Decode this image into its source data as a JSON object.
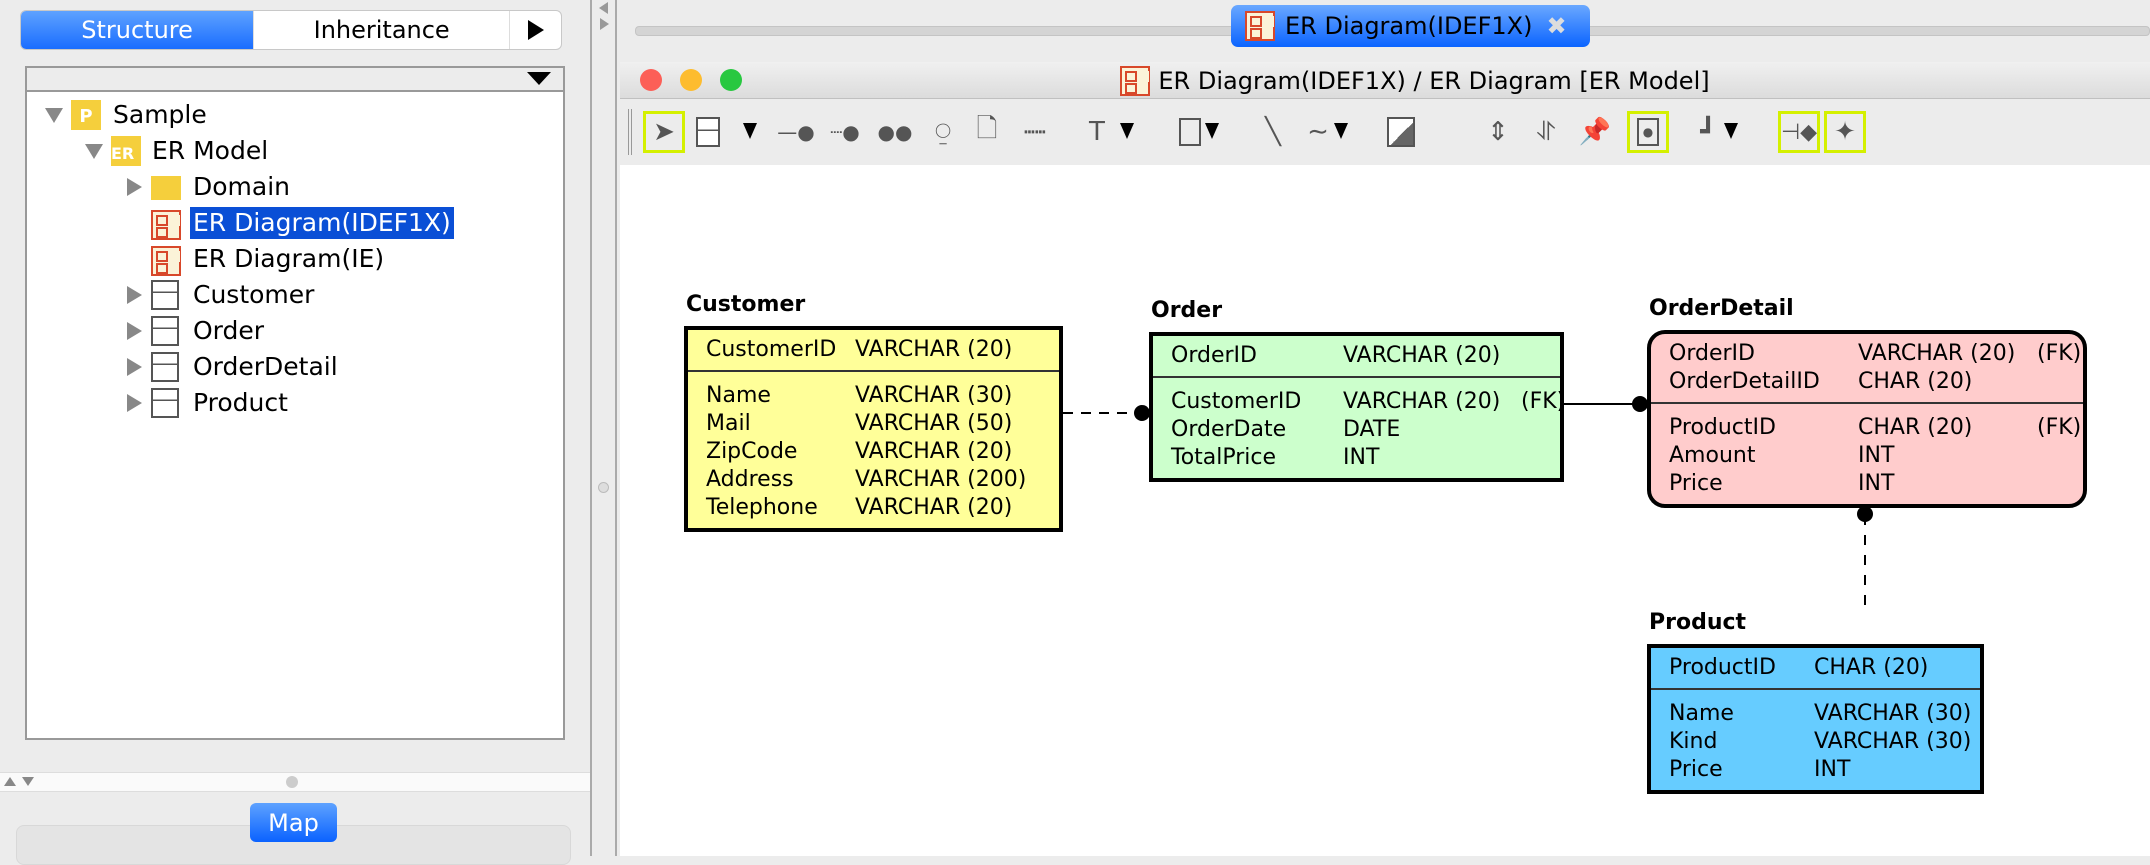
{
  "left_panel": {
    "tabs": [
      {
        "label": "Structure",
        "active": true
      },
      {
        "label": "Inheritance",
        "active": false
      }
    ],
    "tabs_more_icon": "play-right-icon",
    "tree": [
      {
        "label": "Sample",
        "icon": "project-icon",
        "level": 0,
        "expanded": true
      },
      {
        "label": "ER Model",
        "icon": "er-model-icon",
        "level": 1,
        "expanded": true
      },
      {
        "label": "Domain",
        "icon": "folder-icon",
        "level": 2,
        "expanded": false
      },
      {
        "label": "ER Diagram(IDEF1X)",
        "icon": "er-diagram-icon",
        "level": 2,
        "selected": true
      },
      {
        "label": "ER Diagram(IE)",
        "icon": "er-diagram-icon",
        "level": 2
      },
      {
        "label": "Customer",
        "icon": "entity-icon",
        "level": 2,
        "expanded": false
      },
      {
        "label": "Order",
        "icon": "entity-icon",
        "level": 2,
        "expanded": false
      },
      {
        "label": "OrderDetail",
        "icon": "entity-icon",
        "level": 2,
        "expanded": false
      },
      {
        "label": "Product",
        "icon": "entity-icon",
        "level": 2,
        "expanded": false
      }
    ],
    "map_button": "Map"
  },
  "editor": {
    "tab_label": "ER Diagram(IDEF1X)",
    "window_title": "ER Diagram(IDEF1X) / ER Diagram [ER Model]",
    "colors": {
      "selection": "#0a4fd6",
      "accent": "#0b64ff",
      "highlight_tool": "#d4f000"
    }
  },
  "diagram": {
    "entities": [
      {
        "name": "Customer",
        "color": "#ffff99",
        "pk": [
          [
            "CustomerID",
            "VARCHAR (20)",
            ""
          ]
        ],
        "attrs": [
          [
            "Name",
            "VARCHAR (30)",
            ""
          ],
          [
            "Mail",
            "VARCHAR (50)",
            ""
          ],
          [
            "ZipCode",
            "VARCHAR (20)",
            ""
          ],
          [
            "Address",
            "VARCHAR (200)",
            ""
          ],
          [
            "Telephone",
            "VARCHAR (20)",
            ""
          ]
        ]
      },
      {
        "name": "Order",
        "color": "#ccffcc",
        "pk": [
          [
            "OrderID",
            "VARCHAR (20)",
            ""
          ]
        ],
        "attrs": [
          [
            "CustomerID",
            "VARCHAR (20)",
            "(FK)"
          ],
          [
            "OrderDate",
            "DATE",
            ""
          ],
          [
            "TotalPrice",
            "INT",
            ""
          ]
        ]
      },
      {
        "name": "OrderDetail",
        "color": "#ffcccc",
        "pk": [
          [
            "OrderID",
            "VARCHAR (20)",
            "(FK)"
          ],
          [
            "OrderDetailID",
            "CHAR (20)",
            ""
          ]
        ],
        "attrs": [
          [
            "ProductID",
            "CHAR (20)",
            "(FK)"
          ],
          [
            "Amount",
            "INT",
            ""
          ],
          [
            "Price",
            "INT",
            ""
          ]
        ]
      },
      {
        "name": "Product",
        "color": "#66ccff",
        "pk": [
          [
            "ProductID",
            "CHAR (20)",
            ""
          ]
        ],
        "attrs": [
          [
            "Name",
            "VARCHAR (30)",
            ""
          ],
          [
            "Kind",
            "VARCHAR (30)",
            ""
          ],
          [
            "Price",
            "INT",
            ""
          ]
        ]
      }
    ],
    "relationships": [
      {
        "from": "Customer",
        "to": "Order",
        "style": "non-identifying"
      },
      {
        "from": "Order",
        "to": "OrderDetail",
        "style": "identifying"
      },
      {
        "from": "Product",
        "to": "OrderDetail",
        "style": "non-identifying"
      }
    ]
  }
}
